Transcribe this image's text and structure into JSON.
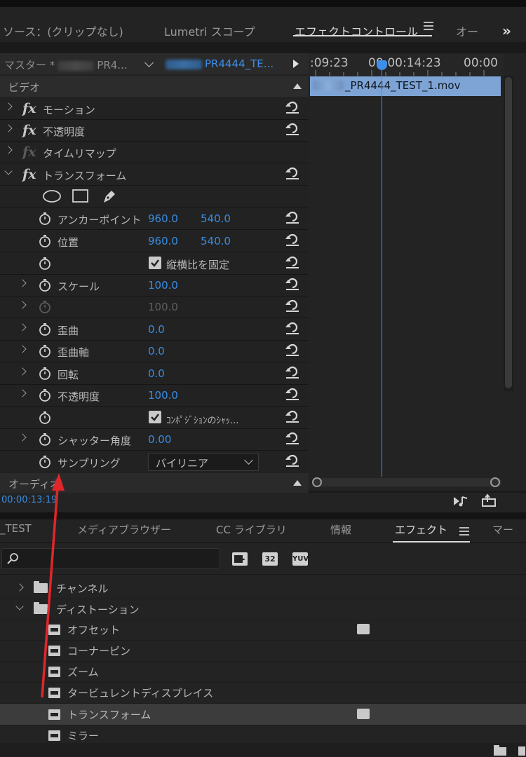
{
  "top_tabs": [
    {
      "label": "ソース：(クリップなし)"
    },
    {
      "label": "Lumetri スコープ"
    },
    {
      "label": "エフェクトコントロール"
    },
    {
      "label": "オー"
    }
  ],
  "master": {
    "left_prefix": "マスター *",
    "left_suffix": "PR4...",
    "right_suffix": "PR4444_TE..."
  },
  "sections": {
    "video": "ビデオ",
    "audio": "オーディオ"
  },
  "effects": {
    "motion": "モーション",
    "opacity": "不透明度",
    "time_remap": "タイムリマップ",
    "transform": "トランスフォーム"
  },
  "transform_props": {
    "anchor": {
      "label": "アンカーポイント",
      "x": "960.0",
      "y": "540.0"
    },
    "position": {
      "label": "位置",
      "x": "960.0",
      "y": "540.0"
    },
    "uniform_scale": "縦横比を固定",
    "scale": {
      "label": "スケール",
      "value": "100.0"
    },
    "scale_width": {
      "value": "100.0"
    },
    "skew": {
      "label": "歪曲",
      "value": "0.0"
    },
    "skew_axis": {
      "label": "歪曲軸",
      "value": "0.0"
    },
    "rotation": {
      "label": "回転",
      "value": "0.0"
    },
    "opacity": {
      "label": "不透明度",
      "value": "100.0"
    },
    "comp_shutter": "ｺﾝﾎﾟｼﾞｼｮﾝのｼｬｯ...",
    "shutter_angle": {
      "label": "シャッター角度",
      "value": "0.00"
    },
    "sampling": {
      "label": "サンプリング",
      "value": "バイリニア"
    }
  },
  "timeline": {
    "tc1": ":09:23",
    "tc2": "00:00:14:23",
    "tc3": "00:00",
    "clip_name": "_PR4444_TEST_1.mov"
  },
  "status_timecode": "00:00:13:19",
  "bottom_tabs": [
    {
      "label": "_TEST"
    },
    {
      "label": "メディアブラウザー"
    },
    {
      "label": "CC ライブラリ"
    },
    {
      "label": "情報"
    },
    {
      "label": "エフェクト"
    },
    {
      "label": "マー"
    }
  ],
  "tool_buttons": {
    "b32": "32",
    "yuv": "YUV"
  },
  "effects_list": {
    "channel": "チャンネル",
    "distortion": "ディストーション",
    "items": [
      {
        "label": "オフセット"
      },
      {
        "label": "コーナーピン"
      },
      {
        "label": "ズーム"
      },
      {
        "label": "タービュレントディスプレイス"
      },
      {
        "label": "トランスフォーム"
      },
      {
        "label": "ミラー"
      }
    ]
  },
  "colors": {
    "accent": "#3a8de4",
    "annotation_arrow": "#e0262b"
  }
}
